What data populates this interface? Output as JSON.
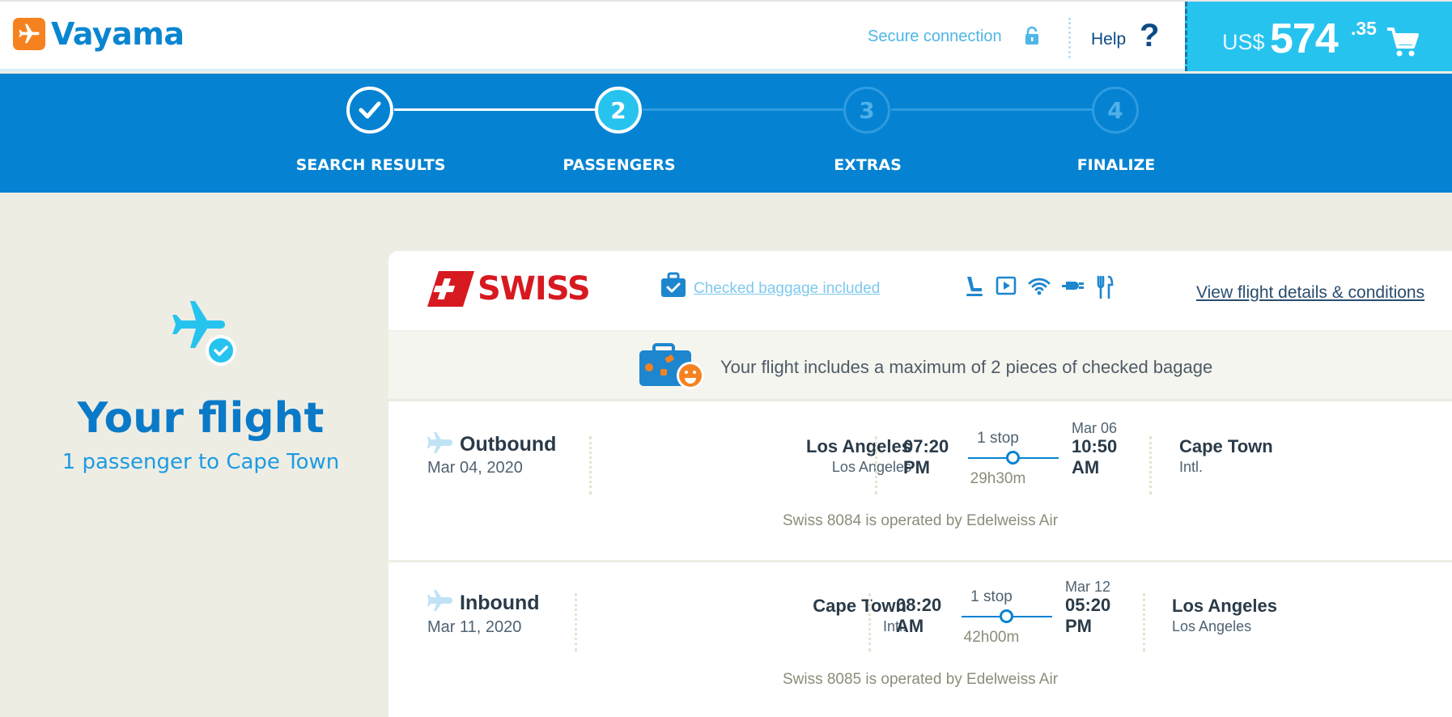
{
  "header": {
    "brand": "Vayama",
    "secure_label": "Secure connection",
    "help_label": "Help",
    "help_symbol": "?",
    "price": {
      "currency": "US$",
      "amount": "574",
      "cents": ".35"
    }
  },
  "steps": [
    {
      "number": "",
      "label": "SEARCH RESULTS",
      "state": "done"
    },
    {
      "number": "2",
      "label": "PASSENGERS",
      "state": "active"
    },
    {
      "number": "3",
      "label": "EXTRAS",
      "state": "todo"
    },
    {
      "number": "4",
      "label": "FINALIZE",
      "state": "todo"
    }
  ],
  "left_panel": {
    "title": "Your flight",
    "subtitle": "1 passenger to Cape Town"
  },
  "card": {
    "airline": "SWISS",
    "baggage_link": "Checked baggage included",
    "details_link": "View flight details & conditions",
    "baggage_banner": "Your flight includes a maximum of 2 pieces of checked bagage",
    "amenities": [
      "seat-icon",
      "video-icon",
      "wifi-icon",
      "power-icon",
      "meal-icon"
    ]
  },
  "flights": [
    {
      "direction": "Outbound",
      "date": "Mar 04, 2020",
      "from_city": "Los Angeles",
      "from_sub": "Los Angeles",
      "dep_time": "07:20",
      "dep_ampm": "PM",
      "stops": "1 stop",
      "duration": "29h30m",
      "arr_date": "Mar 06",
      "arr_time": "10:50",
      "arr_ampm": "AM",
      "to_city": "Cape Town",
      "to_sub": "Intl.",
      "operated": "Swiss 8084 is operated by Edelweiss Air"
    },
    {
      "direction": "Inbound",
      "date": "Mar 11, 2020",
      "from_city": "Cape Town",
      "from_sub": "Intl.",
      "dep_time": "08:20",
      "dep_ampm": "AM",
      "stops": "1 stop",
      "duration": "42h00m",
      "arr_date": "Mar 12",
      "arr_time": "05:20",
      "arr_ampm": "PM",
      "to_city": "Los Angeles",
      "to_sub": "Los Angeles",
      "operated": "Swiss 8085 is operated by Edelweiss Air"
    }
  ],
  "colors": {
    "brand_blue": "#0583d2",
    "accent_cyan": "#27c3ef",
    "orange": "#f6821f",
    "swiss_red": "#d71920"
  }
}
